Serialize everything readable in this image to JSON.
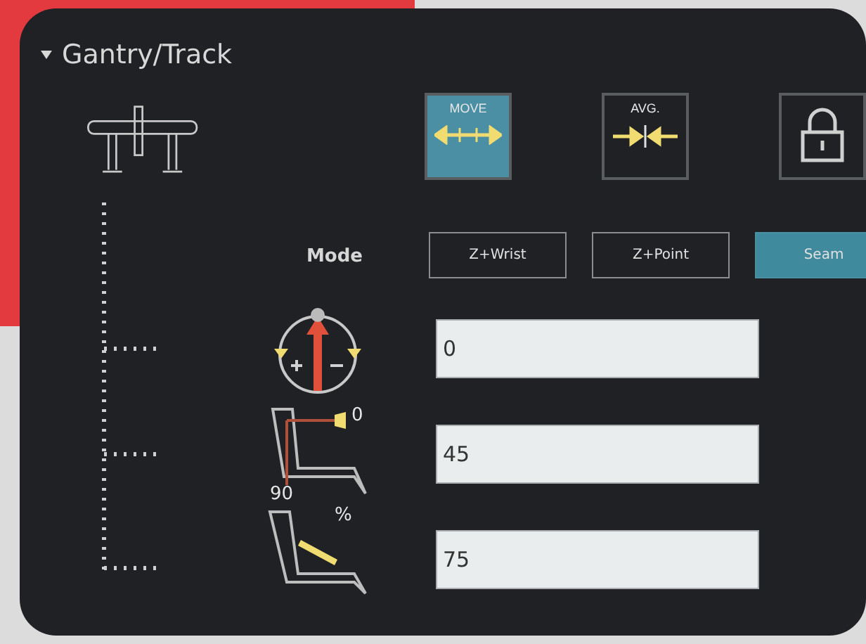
{
  "section": {
    "title": "Gantry/Track",
    "expanded": true
  },
  "tool_buttons": [
    {
      "kind": "move",
      "label": "MOVE",
      "selected": true
    },
    {
      "kind": "average",
      "label": "AVG.",
      "selected": false
    },
    {
      "kind": "lock",
      "selected": false
    }
  ],
  "mode": {
    "label": "Mode",
    "options": [
      {
        "label": "Z+Wrist",
        "selected": false
      },
      {
        "label": "Z+Point",
        "selected": false
      },
      {
        "label": "Seam",
        "selected": true
      }
    ]
  },
  "params": [
    {
      "kind": "rotation",
      "value": "0"
    },
    {
      "kind": "angle",
      "value": "45",
      "marks": [
        "0",
        "90"
      ]
    },
    {
      "kind": "speed",
      "value": "75",
      "marks": [
        "%"
      ]
    }
  ]
}
